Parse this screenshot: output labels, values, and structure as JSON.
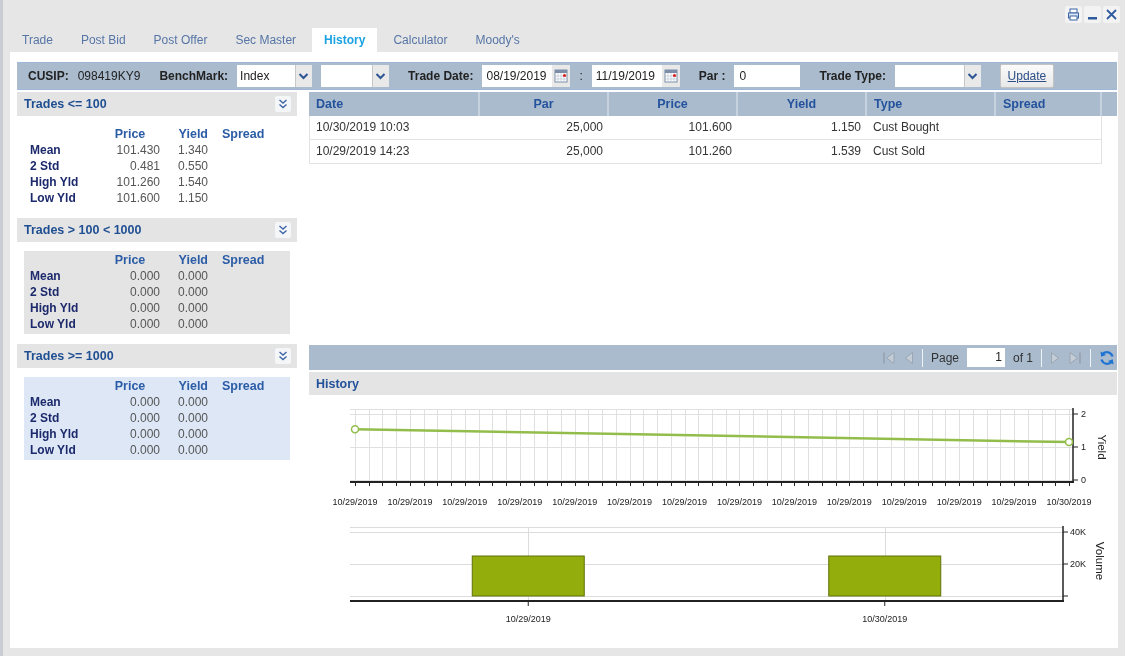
{
  "window": {
    "controls": [
      {
        "kind": "print"
      },
      {
        "kind": "minimize"
      },
      {
        "kind": "close"
      }
    ]
  },
  "tabs": [
    {
      "label": "Trade",
      "selected": false
    },
    {
      "label": "Post Bid",
      "selected": false
    },
    {
      "label": "Post Offer",
      "selected": false
    },
    {
      "label": "Sec Master",
      "selected": false
    },
    {
      "label": "History",
      "selected": true
    },
    {
      "label": "Calculator",
      "selected": false
    },
    {
      "label": "Moody's",
      "selected": false
    }
  ],
  "toolbar": [
    {
      "kind": "label",
      "text": "CUSIP:"
    },
    {
      "kind": "text",
      "text": "098419KY9"
    },
    {
      "kind": "label",
      "text": "BenchMark:"
    },
    {
      "kind": "select",
      "value": "Index"
    },
    {
      "kind": "select"
    },
    {
      "kind": "label",
      "text": "Trade Date:"
    },
    {
      "kind": "date",
      "value": "08/19/2019"
    },
    {
      "kind": "text",
      "text": ":"
    },
    {
      "kind": "date",
      "value": "11/19/2019"
    },
    {
      "kind": "label",
      "text": "Par :"
    },
    {
      "kind": "input",
      "value": "0"
    },
    {
      "kind": "label",
      "text": "Trade Type:"
    },
    {
      "kind": "select"
    },
    {
      "kind": "button",
      "label": "Update"
    }
  ],
  "stat_panels": [
    {
      "title": "Trades <= 100",
      "color": "#ffffff",
      "columns": [
        "Price",
        "Yield",
        "Spread"
      ],
      "rows": [
        {
          "label": "Mean",
          "price": "101.430",
          "yield": "1.340"
        },
        {
          "label": "2 Std",
          "price": "0.481",
          "yield": "0.550"
        },
        {
          "label": "High Yld",
          "price": "101.260",
          "yield": "1.540"
        },
        {
          "label": "Low Yld",
          "price": "101.600",
          "yield": "1.150"
        }
      ]
    },
    {
      "title": "Trades > 100 < 1000",
      "color": "#e4e4e4",
      "columns": [
        "Price",
        "Yield",
        "Spread"
      ],
      "rows": [
        {
          "label": "Mean",
          "price": "0.000",
          "yield": "0.000"
        },
        {
          "label": "2 Std",
          "price": "0.000",
          "yield": "0.000"
        },
        {
          "label": "High Yld",
          "price": "0.000",
          "yield": "0.000"
        },
        {
          "label": "Low Yld",
          "price": "0.000",
          "yield": "0.000"
        }
      ]
    },
    {
      "title": "Trades >= 1000",
      "color": "#dde7f6",
      "columns": [
        "Price",
        "Yield",
        "Spread"
      ],
      "rows": [
        {
          "label": "Mean",
          "price": "0.000",
          "yield": "0.000"
        },
        {
          "label": "2 Std",
          "price": "0.000",
          "yield": "0.000"
        },
        {
          "label": "High Yld",
          "price": "0.000",
          "yield": "0.000"
        },
        {
          "label": "Low Yld",
          "price": "0.000",
          "yield": "0.000"
        }
      ]
    }
  ],
  "trades_table": {
    "columns": [
      "Date",
      "Par",
      "Price",
      "Yield",
      "Type",
      "Spread"
    ],
    "rows": [
      {
        "date": "10/30/2019 10:03",
        "par": "25,000",
        "price": "101.600",
        "yield": "1.150",
        "type": "Cust Bought"
      },
      {
        "date": "10/29/2019 14:23",
        "par": "25,000",
        "price": "101.260",
        "yield": "1.539",
        "type": "Cust Sold"
      }
    ]
  },
  "pager": {
    "buttons_left": [
      {
        "kind": "first",
        "disabled": true
      },
      {
        "kind": "prev",
        "disabled": true
      }
    ],
    "page_label": "Page",
    "page": "1",
    "page_count": "of 1",
    "buttons_right": [
      {
        "kind": "next",
        "disabled": true
      },
      {
        "kind": "last",
        "disabled": true
      },
      {
        "kind": "refresh",
        "disabled": false
      }
    ]
  },
  "history": {
    "title": "History",
    "yield_chart": {
      "chart_data": {
        "type": "line",
        "ylabel": "Yield",
        "categories": [
          "10/29/2019",
          "10/29/2019",
          "10/29/2019",
          "10/29/2019",
          "10/29/2019",
          "10/29/2019",
          "10/29/2019",
          "10/29/2019",
          "10/29/2019",
          "10/29/2019",
          "10/29/2019",
          "10/29/2019",
          "10/29/2019",
          "10/30/2019"
        ],
        "ylim": [
          0,
          2
        ],
        "yticks": [
          0,
          1,
          2
        ],
        "grid": true,
        "series": [
          {
            "color": "#93bd4a",
            "marker": "circle",
            "values": [
              1.54,
              null,
              null,
              null,
              null,
              null,
              null,
              null,
              null,
              null,
              null,
              null,
              null,
              1.15
            ]
          }
        ]
      }
    },
    "volume_chart": {
      "chart_data": {
        "type": "bar",
        "ylabel": "Volume",
        "categories": [
          "10/29/2019",
          "10/30/2019"
        ],
        "ylim": [
          0,
          40000
        ],
        "yticks": [
          {
            "value": 20000,
            "label": "20K"
          },
          {
            "value": 40000,
            "label": "40K"
          }
        ],
        "grid": true,
        "series": [
          {
            "color": "#93ae0c",
            "values": [
              25000,
              25000
            ]
          }
        ]
      }
    }
  }
}
